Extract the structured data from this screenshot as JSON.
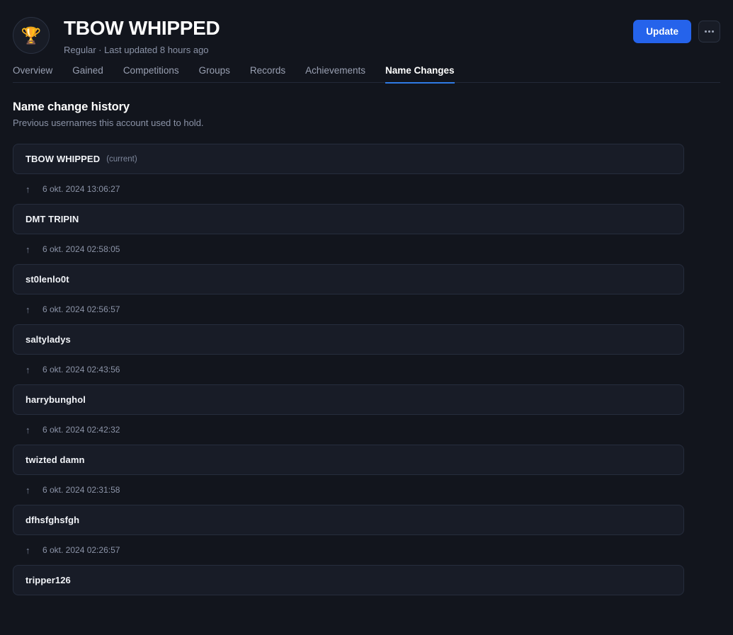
{
  "header": {
    "avatar_icon": "trophy-icon",
    "avatar_glyph": "🏆",
    "title": "TBOW WHIPPED",
    "subtitle": "Regular · Last updated 8 hours ago",
    "update_label": "Update",
    "more_label": "···"
  },
  "tabs": [
    {
      "label": "Overview",
      "active": false
    },
    {
      "label": "Gained",
      "active": false
    },
    {
      "label": "Competitions",
      "active": false
    },
    {
      "label": "Groups",
      "active": false
    },
    {
      "label": "Records",
      "active": false
    },
    {
      "label": "Achievements",
      "active": false
    },
    {
      "label": "Name Changes",
      "active": true
    }
  ],
  "section": {
    "title": "Name change history",
    "subtitle": "Previous usernames this account used to hold."
  },
  "entries": [
    {
      "name": "TBOW WHIPPED",
      "current_tag": "(current)",
      "date": "6 okt. 2024 13:06:27"
    },
    {
      "name": "DMT TRIPIN",
      "current_tag": "",
      "date": "6 okt. 2024 02:58:05"
    },
    {
      "name": "st0lenlo0t",
      "current_tag": "",
      "date": "6 okt. 2024 02:56:57"
    },
    {
      "name": "saltyladys",
      "current_tag": "",
      "date": "6 okt. 2024 02:43:56"
    },
    {
      "name": "harrybunghol",
      "current_tag": "",
      "date": "6 okt. 2024 02:42:32"
    },
    {
      "name": "twizted damn",
      "current_tag": "",
      "date": "6 okt. 2024 02:31:58"
    },
    {
      "name": "dfhsfghsfgh",
      "current_tag": "",
      "date": "6 okt. 2024 02:26:57"
    },
    {
      "name": "tripper126",
      "current_tag": "",
      "date": ""
    }
  ],
  "icons": {
    "arrow_up": "↑"
  },
  "colors": {
    "page_bg": "#12151d",
    "card_bg": "#181c27",
    "card_border": "#262d3d",
    "accent_blue": "#2563eb",
    "tab_underline": "#2f7ae5",
    "text_primary": "#ffffff",
    "text_muted": "#8b93a7",
    "trophy_gold": "#e8b93a"
  }
}
